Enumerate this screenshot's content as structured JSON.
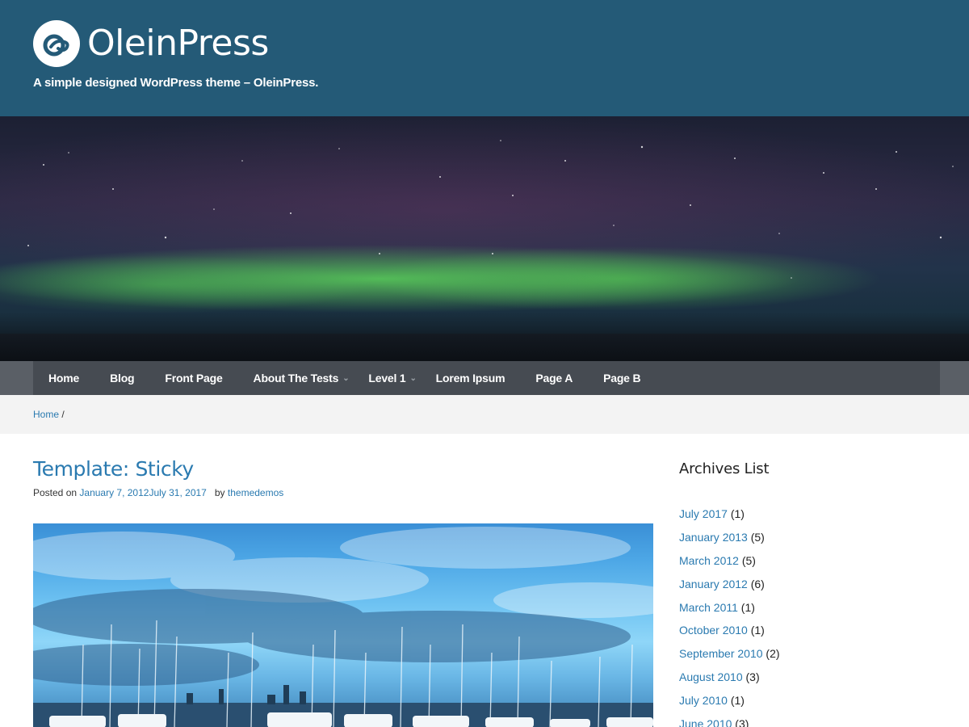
{
  "header": {
    "site_title": "OleinPress",
    "tagline": "A simple designed WordPress theme – OleinPress.",
    "logo_icon": "oleinpress-logo-icon",
    "background_color": "#245a77"
  },
  "nav": {
    "items": [
      {
        "label": "Home",
        "has_submenu": false
      },
      {
        "label": "Blog",
        "has_submenu": false
      },
      {
        "label": "Front Page",
        "has_submenu": false
      },
      {
        "label": "About The Tests",
        "has_submenu": true
      },
      {
        "label": "Level 1",
        "has_submenu": true
      },
      {
        "label": "Lorem Ipsum",
        "has_submenu": false
      },
      {
        "label": "Page A",
        "has_submenu": false
      },
      {
        "label": "Page B",
        "has_submenu": false
      }
    ],
    "submenu_icon": "chevron-down-icon"
  },
  "breadcrumb": {
    "home": "Home",
    "separator": "/"
  },
  "post": {
    "title": "Template: Sticky",
    "posted_on_label": "Posted on",
    "date": "January 7, 2012July 31, 2017",
    "by_label": "by",
    "author": "themedemos"
  },
  "sidebar": {
    "title": "Archives List",
    "archives": [
      {
        "label": "July 2017",
        "count": "(1)"
      },
      {
        "label": "January 2013",
        "count": "(5)"
      },
      {
        "label": "March 2012",
        "count": "(5)"
      },
      {
        "label": "January 2012",
        "count": "(6)"
      },
      {
        "label": "March 2011",
        "count": "(1)"
      },
      {
        "label": "October 2010",
        "count": "(1)"
      },
      {
        "label": "September 2010",
        "count": "(2)"
      },
      {
        "label": "August 2010",
        "count": "(3)"
      },
      {
        "label": "July 2010",
        "count": "(1)"
      },
      {
        "label": "June 2010",
        "count": "(3)"
      }
    ]
  },
  "colors": {
    "link": "#2a7ab0",
    "nav_background": "#464b52",
    "breadcrumb_background": "#f3f3f3"
  }
}
